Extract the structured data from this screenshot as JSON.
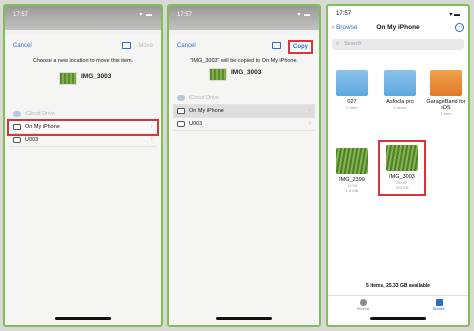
{
  "phone1": {
    "time": "17:57",
    "status_icons": "▾ ▬",
    "cancel": "Cancel",
    "move": "Move",
    "prompt": "Choose a new location to move this item.",
    "file_name": "IMG_3003",
    "locations": [
      {
        "label": "iCloud Drive",
        "icon": "cloud-icon"
      },
      {
        "label": "On My iPhone",
        "icon": "phone-icon"
      },
      {
        "label": "U003",
        "icon": "drive-icon"
      }
    ]
  },
  "phone2": {
    "time": "17:57",
    "status_icons": "▾ ▬",
    "cancel": "Cancel",
    "copy": "Copy",
    "prompt": "\"IMG_3003\" will be copied to On My iPhone.",
    "file_name": "IMG_3003",
    "locations": [
      {
        "label": "iCloud Drive",
        "icon": "cloud-icon"
      },
      {
        "label": "On My iPhone",
        "icon": "phone-icon"
      },
      {
        "label": "U003",
        "icon": "drive-icon"
      }
    ]
  },
  "phone3": {
    "time": "17:57",
    "status_icons": "▾ ▬",
    "back": "‹ Browse",
    "title": "On My iPhone",
    "more": "···",
    "search_placeholder": "Search",
    "tiles": [
      {
        "name": "027",
        "meta": "1 item",
        "type": "folder"
      },
      {
        "name": "Asfocla pro",
        "meta": "0 items",
        "type": "folder"
      },
      {
        "name": "GarageBand for iOS",
        "meta": "1 item",
        "type": "garageband"
      },
      {
        "name": "IMG_2399",
        "meta": "12:09\n1.6 MB",
        "type": "photo"
      },
      {
        "name": "IMG_3003",
        "meta": "00:57\n322 KB",
        "type": "photo"
      }
    ],
    "count": "5 items, 25.33 GB available",
    "tabs": [
      {
        "label": "Recents"
      },
      {
        "label": "Browse"
      }
    ]
  },
  "colors": {
    "accent": "#2a6ccf",
    "highlight": "#d9363c",
    "frame": "#7fbf5a"
  }
}
